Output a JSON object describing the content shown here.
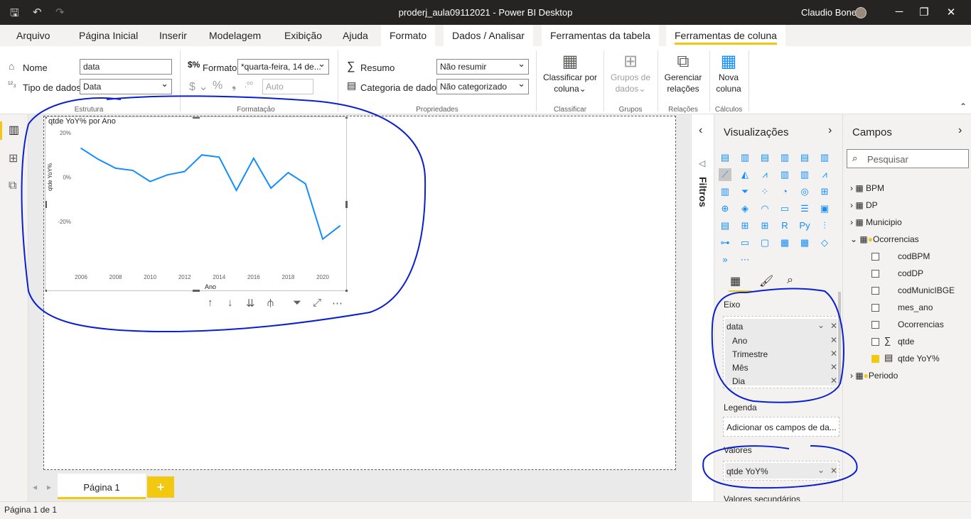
{
  "window": {
    "title": "proderj_aula09112021 - Power BI Desktop",
    "user": "Claudio Bonel"
  },
  "menu": {
    "tabs": [
      "Arquivo",
      "Página Inicial",
      "Inserir",
      "Modelagem",
      "Exibição",
      "Ajuda"
    ],
    "context_tabs": [
      "Formato",
      "Dados / Analisar",
      "Ferramentas da tabela",
      "Ferramentas de coluna"
    ],
    "active_tab": "Ferramentas de coluna"
  },
  "ribbon": {
    "nome_label": "Nome",
    "nome_value": "data",
    "tipo_label": "Tipo de dados",
    "tipo_value": "Data",
    "estrutura": "Estrutura",
    "formato_label": "Formato",
    "formato_value": "*quarta-feira, 14 de...",
    "auto_value": "Auto",
    "formatacao": "Formatação",
    "resumo_label": "Resumo",
    "resumo_value": "Não resumir",
    "categoria_label": "Categoria de dados",
    "categoria_value": "Não categorizado",
    "propriedades": "Propriedades",
    "classificar_btn": [
      "Classificar por",
      "coluna"
    ],
    "classificar_group": "Classificar",
    "grupos_btn": [
      "Grupos de",
      "dados"
    ],
    "grupos_group": "Grupos",
    "gerenciar_btn": [
      "Gerenciar",
      "relações"
    ],
    "relacoes_group": "Relações",
    "nova_btn": [
      "Nova",
      "coluna"
    ],
    "calculos_group": "Cálculos"
  },
  "visual": {
    "title": "qtde YoY% por Ano"
  },
  "chart_data": {
    "type": "line",
    "title": "qtde YoY% por Ano",
    "xlabel": "Ano",
    "ylabel": "qtde YoY%",
    "x": [
      2006,
      2007,
      2008,
      2009,
      2010,
      2011,
      2012,
      2013,
      2014,
      2015,
      2016,
      2017,
      2018,
      2019,
      2020,
      2021
    ],
    "series": [
      {
        "values": [
          13,
          8,
          4,
          3,
          -2,
          1,
          2.5,
          10,
          9,
          -6,
          8.5,
          -5,
          2,
          -3,
          -28,
          -22
        ],
        "color": "#118dff"
      }
    ],
    "x_ticks": [
      "2006",
      "2008",
      "2010",
      "2012",
      "2014",
      "2016",
      "2018",
      "2020"
    ],
    "y_ticks": [
      "20%",
      "0%",
      "-20%"
    ],
    "ylim": [
      -30,
      20
    ],
    "grid": false
  },
  "pages": {
    "tab": "Página 1",
    "add": "+"
  },
  "filters": {
    "label": "Filtros"
  },
  "viz": {
    "title": "Visualizações",
    "eixo_label": "Eixo",
    "eixo_field": "data",
    "eixo_sub": [
      "Ano",
      "Trimestre",
      "Mês",
      "Dia"
    ],
    "legenda_label": "Legenda",
    "legenda_placeholder": "Adicionar os campos de da...",
    "valores_label": "Valores",
    "valores_field": "qtde YoY%",
    "secundarios_label": "Valores secundários"
  },
  "fields": {
    "title": "Campos",
    "search_placeholder": "Pesquisar",
    "tables": [
      "BPM",
      "DP",
      "Municipio",
      "Ocorrencias"
    ],
    "oc_fields": [
      "codBPM",
      "codDP",
      "codMunicIBGE",
      "mes_ano",
      "Ocorrencias",
      "qtde",
      "qtde YoY%"
    ],
    "last_table": "Periodo"
  },
  "status": {
    "text": "Página 1 de 1"
  }
}
